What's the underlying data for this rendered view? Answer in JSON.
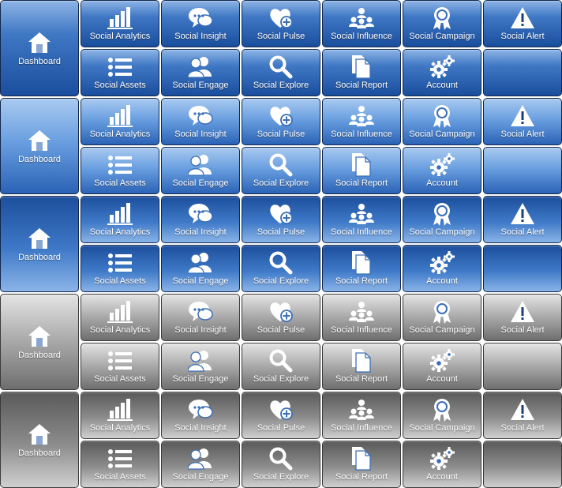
{
  "dashboard_label": "Dashboard",
  "tiles": [
    {
      "id": "social-analytics",
      "label": "Social Analytics",
      "icon": "bar-chart-icon"
    },
    {
      "id": "social-insight",
      "label": "Social Insight",
      "icon": "speech-bubbles-icon"
    },
    {
      "id": "social-pulse",
      "label": "Social Pulse",
      "icon": "heart-plus-icon"
    },
    {
      "id": "social-influence",
      "label": "Social Influence",
      "icon": "people-network-icon"
    },
    {
      "id": "social-campaign",
      "label": "Social Campaign",
      "icon": "award-ribbon-icon"
    },
    {
      "id": "social-alert",
      "label": "Social Alert",
      "icon": "warning-triangle-icon"
    },
    {
      "id": "social-assets",
      "label": "Social Assets",
      "icon": "list-icon"
    },
    {
      "id": "social-engage",
      "label": "Social Engage",
      "icon": "users-icon"
    },
    {
      "id": "social-explore",
      "label": "Social Explore",
      "icon": "magnifier-icon"
    },
    {
      "id": "social-report",
      "label": "Social Report",
      "icon": "documents-icon"
    },
    {
      "id": "account",
      "label": "Account",
      "icon": "gears-icon"
    }
  ],
  "themes": [
    {
      "name": "blue-glossy"
    },
    {
      "name": "blue-light"
    },
    {
      "name": "blue-inverted"
    },
    {
      "name": "gray-glossy"
    },
    {
      "name": "gray-inverted"
    }
  ]
}
